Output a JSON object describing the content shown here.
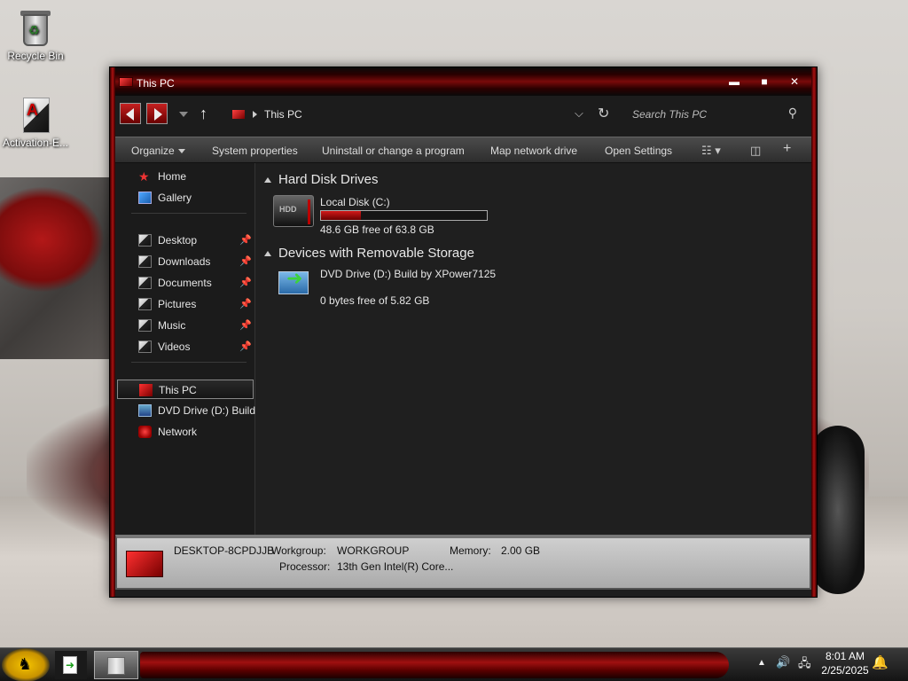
{
  "desktop": {
    "icons": [
      {
        "label": "Recycle Bin"
      },
      {
        "label": "Activation-E..."
      }
    ]
  },
  "window": {
    "title": "This PC",
    "controls": {
      "minimize": "▬",
      "maximize": "■",
      "close": "✕"
    },
    "address": {
      "crumb": "This PC"
    },
    "search": {
      "placeholder": "Search This PC"
    },
    "commands": {
      "organize": "Organize",
      "system_properties": "System properties",
      "uninstall": "Uninstall or change a program",
      "map_drive": "Map network drive",
      "open_settings": "Open Settings"
    },
    "nav": {
      "home": "Home",
      "gallery": "Gallery",
      "desktop": "Desktop",
      "downloads": "Downloads",
      "documents": "Documents",
      "pictures": "Pictures",
      "music": "Music",
      "videos": "Videos",
      "this_pc": "This PC",
      "dvd": "DVD Drive (D:) Build",
      "network": "Network"
    },
    "groups": {
      "hdd": "Hard Disk Drives",
      "removable": "Devices with Removable Storage"
    },
    "drives": {
      "c": {
        "name": "Local Disk (C:)",
        "free": "48.6 GB free of 63.8 GB",
        "hdd_label": "HDD",
        "used_fraction": 0.24
      },
      "d": {
        "name": "DVD Drive (D:) Build by XPower7125",
        "free": "0 bytes free of 5.82 GB"
      }
    },
    "details": {
      "computer": "DESKTOP-8CPDJJB",
      "workgroup_label": "Workgroup:",
      "workgroup": "WORKGROUP",
      "memory_label": "Memory:",
      "memory": "2.00 GB",
      "processor_label": "Processor:",
      "processor": "13th Gen Intel(R) Core..."
    }
  },
  "taskbar": {
    "time": "8:01 AM",
    "date": "2/25/2025"
  },
  "colors": {
    "accent": "#b00000"
  }
}
